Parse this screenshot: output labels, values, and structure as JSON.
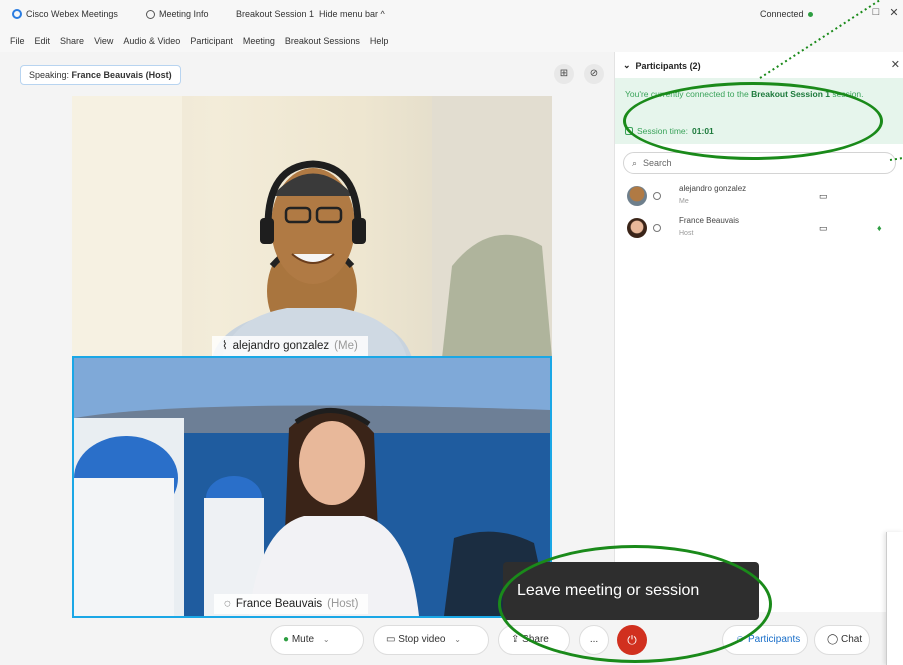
{
  "titlebar": {
    "app_name": "Cisco Webex Meetings",
    "meeting_info": "Meeting Info",
    "session_name": "Breakout Session 1",
    "hide_menu": "Hide menu bar ^",
    "status": "Connected",
    "status_color": "#2e9e42"
  },
  "menu": [
    "File",
    "Edit",
    "Share",
    "View",
    "Audio & Video",
    "Participant",
    "Meeting",
    "Breakout Sessions",
    "Help"
  ],
  "stage": {
    "speaking_prefix": "Speaking:",
    "speaking_name": "France Beauvais (Host)"
  },
  "videos": [
    {
      "name": "alejandro gonzalez",
      "suffix": "(Me)"
    },
    {
      "name": "France Beauvais",
      "suffix": "(Host)"
    }
  ],
  "panel": {
    "title": "Participants (2)",
    "banner_prefix": "You're currently connected to the",
    "banner_session": "Breakout Session 1",
    "banner_suffix": "session.",
    "session_time_label": "Session time:",
    "session_time": "01:01",
    "search_placeholder": "Search",
    "participants": [
      {
        "name": "alejandro gonzalez",
        "role": "Me"
      },
      {
        "name": "France Beauvais",
        "role": "Host"
      }
    ]
  },
  "controls": {
    "mute": "Mute",
    "stop_video": "Stop video",
    "share": "Share",
    "more": "...",
    "participants": "Participants",
    "chat": "Chat"
  },
  "tooltip": "Leave meeting or session",
  "colors": {
    "accent_green": "#1a8a1a",
    "leave_red": "#d1301f",
    "active_border": "#1aa7e6"
  }
}
